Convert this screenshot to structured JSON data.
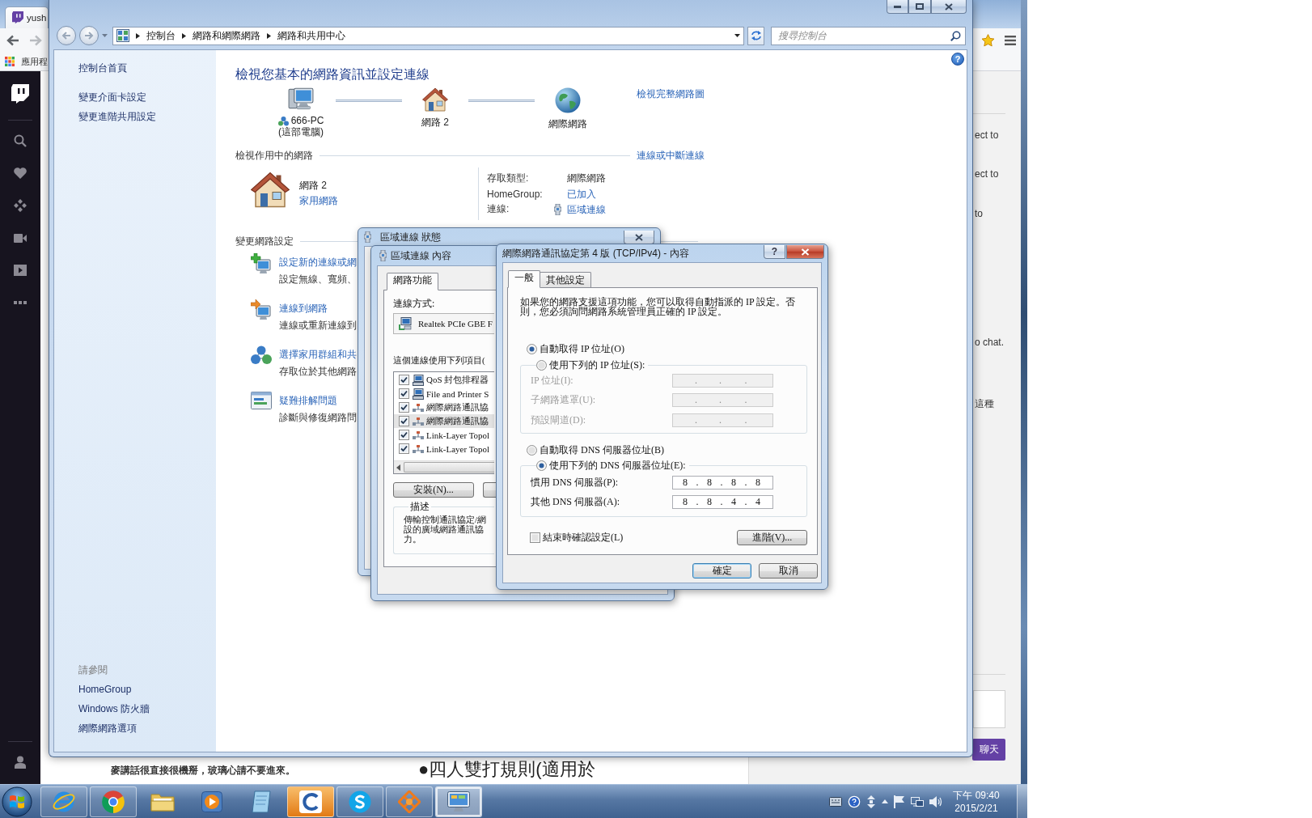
{
  "browser": {
    "tab": {
      "title": "yush"
    },
    "bookmarks_bar": {
      "apps_label": "應用程"
    },
    "page": {
      "lines": [
        {
          "kind": "note",
          "text": "麥講話很直接很機掰，玻璃心請不要進來。"
        },
        {
          "kind": "heading",
          "text": "●四人雙打規則(適用於"
        }
      ]
    },
    "chat": {
      "messages": [
        "ect to",
        "ect to",
        "to",
        "o chat.",
        "這種"
      ],
      "send_button": "聊天"
    }
  },
  "control_panel": {
    "breadcrumbs": [
      "控制台",
      "網路和網際網路",
      "網路和共用中心"
    ],
    "search": {
      "placeholder": "搜尋控制台"
    },
    "help_button": "?",
    "sidebar": {
      "links": [
        "控制台首頁",
        "變更介面卡設定",
        "變更進階共用設定"
      ],
      "see_also": {
        "title": "請參閱",
        "links": [
          "HomeGroup",
          "Windows 防火牆",
          "網際網路選項"
        ]
      }
    },
    "title": "檢視您基本的網路資訊並設定連線",
    "network_map": {
      "nodes": [
        {
          "kind": "computer",
          "label": "666-PC",
          "sublabel": "(這部電腦)"
        },
        {
          "kind": "network",
          "label": "網路 2"
        },
        {
          "kind": "internet",
          "label": "網際網路"
        }
      ],
      "full_map_link": "檢視完整網路圖"
    },
    "active_networks": {
      "heading": "檢視作用中的網路",
      "link": "連線或中斷連線",
      "network": {
        "name": "網路 2",
        "category": "家用網路"
      },
      "details": [
        {
          "kind": "text",
          "label": "存取類型:",
          "value": "網際網路"
        },
        {
          "kind": "link",
          "label": "HomeGroup:",
          "value": "已加入"
        },
        {
          "kind": "connection",
          "label": "連線:",
          "value": "區域連線"
        }
      ]
    },
    "change_settings": {
      "heading": "變更網路設定",
      "tasks": [
        {
          "kind": "new_connection",
          "title": "設定新的連線或網",
          "description": "設定無線、寬頻、"
        },
        {
          "kind": "connect",
          "title": "連線到網路",
          "description": "連線或重新連線到"
        },
        {
          "kind": "homegroup",
          "title": "選擇家用群組和共",
          "description": "存取位於其他網路"
        },
        {
          "kind": "troubleshoot",
          "title": "疑難排解問題",
          "description": "診斷與修復網路問"
        }
      ]
    }
  },
  "status_dialog": {
    "title": "區域連線 狀態"
  },
  "properties_dialog": {
    "title": "區域連線 內容",
    "tabs": [
      {
        "label": "網路功能",
        "selected": true
      }
    ],
    "connect_using": {
      "label": "連線方式:",
      "adapter": "Realtek PCIe GBE F"
    },
    "items_label": "這個連線使用下列項目(",
    "items": [
      {
        "kind": "service",
        "label": "QoS 封包排程器",
        "checked": true,
        "selected": false
      },
      {
        "kind": "service",
        "label": "File and Printer S",
        "checked": true,
        "selected": false
      },
      {
        "kind": "protocol",
        "label": "網際網路通訊協",
        "checked": true,
        "selected": false
      },
      {
        "kind": "protocol",
        "label": "網際網路通訊協",
        "checked": true,
        "selected": true
      },
      {
        "kind": "protocol",
        "label": "Link-Layer Topol",
        "checked": true,
        "selected": false
      },
      {
        "kind": "protocol",
        "label": "Link-Layer Topol",
        "checked": true,
        "selected": false
      }
    ],
    "install_button": "安裝(N)...",
    "description": {
      "title": "描述",
      "lines": [
        "傳輸控制通訊協定/網",
        "設的廣域網路通訊協",
        "力。"
      ]
    }
  },
  "tcp_dialog": {
    "title": "網際網路通訊協定第 4 版 (TCP/IPv4) - 內容",
    "help_button": "?",
    "tabs": [
      {
        "label": "一般",
        "selected": true
      },
      {
        "label": "其他設定",
        "selected": false
      }
    ],
    "intro": "如果您的網路支援這項功能，您可以取得自動指派的 IP 設定。否則，您必須詢問網路系統管理員正確的 IP 設定。",
    "ip": {
      "options": [
        {
          "label": "自動取得 IP 位址(O)",
          "selected": true
        },
        {
          "label": "使用下列的 IP 位址(S):",
          "selected": false
        }
      ],
      "fields": [
        {
          "label": "IP 位址(I):",
          "value": ". . .",
          "disabled": true
        },
        {
          "label": "子網路遮罩(U):",
          "value": ". . .",
          "disabled": true
        },
        {
          "label": "預設閘道(D):",
          "value": ". . .",
          "disabled": true
        }
      ]
    },
    "dns": {
      "options": [
        {
          "label": "自動取得 DNS 伺服器位址(B)",
          "selected": false
        },
        {
          "label": "使用下列的 DNS 伺服器位址(E):",
          "selected": true
        }
      ],
      "fields": [
        {
          "label": "慣用 DNS 伺服器(P):",
          "value": "8 . 8 . 8 . 8",
          "disabled": false
        },
        {
          "label": "其他 DNS 伺服器(A):",
          "value": "8 . 8 . 4 . 4",
          "disabled": false
        }
      ]
    },
    "validate_on_exit": {
      "label": "結束時確認設定(L)",
      "checked": false
    },
    "advanced_button": "進階(V)...",
    "buttons": [
      {
        "label": "確定",
        "default": true
      },
      {
        "label": "取消",
        "default": false
      }
    ]
  },
  "taskbar": {
    "apps": [
      {
        "kind": "ring",
        "running": true,
        "selected": false,
        "flashing": false
      },
      {
        "kind": "wheel",
        "running": true,
        "selected": false,
        "flashing": false
      },
      {
        "kind": "folder",
        "running": false,
        "selected": false,
        "flashing": false
      },
      {
        "kind": "player",
        "running": false,
        "selected": false,
        "flashing": false
      },
      {
        "kind": "notebook",
        "running": false,
        "selected": false,
        "flashing": false
      },
      {
        "kind": "swirl",
        "running": true,
        "selected": false,
        "flashing": true
      },
      {
        "kind": "bubble",
        "running": true,
        "selected": false,
        "flashing": false
      },
      {
        "kind": "knot",
        "running": true,
        "selected": false,
        "flashing": false
      },
      {
        "kind": "monitor",
        "running": true,
        "selected": true,
        "flashing": false
      }
    ],
    "clock": {
      "time": "下午 09:40",
      "date": "2015/2/21"
    }
  }
}
